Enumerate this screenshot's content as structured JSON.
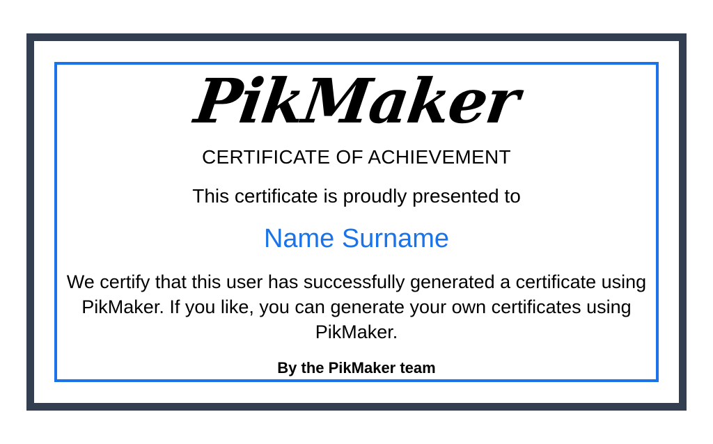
{
  "certificate": {
    "logo_text": "PikMaker",
    "title": "CERTIFICATE OF ACHIEVEMENT",
    "presented_to": "This certificate is proudly presented to",
    "recipient_name": "Name Surname",
    "body": "We certify that this user has successfully generated a certificate using PikMaker. If you like, you can generate your own certificates using PikMaker.",
    "signature": "By the PikMaker team"
  },
  "colors": {
    "outer_frame": "#333f50",
    "inner_frame": "#1a73e8",
    "recipient_text": "#1a73e8",
    "background": "#ffffff"
  }
}
